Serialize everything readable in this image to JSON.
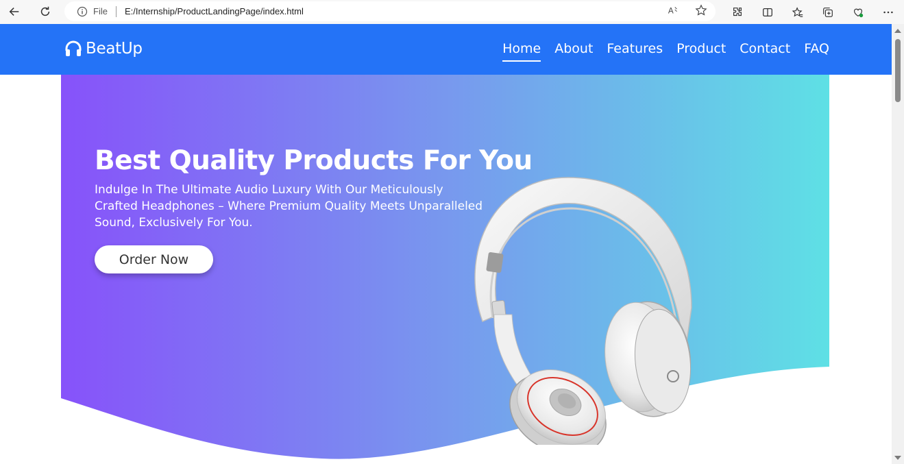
{
  "browser": {
    "scheme_label": "File",
    "url": "E:/Internship/ProductLandingPage/index.html"
  },
  "site": {
    "brand": "BeatUp",
    "nav": [
      {
        "label": "Home",
        "active": true
      },
      {
        "label": "About",
        "active": false
      },
      {
        "label": "Features",
        "active": false
      },
      {
        "label": "Product",
        "active": false
      },
      {
        "label": "Contact",
        "active": false
      },
      {
        "label": "FAQ",
        "active": false
      }
    ]
  },
  "hero": {
    "title": "Best Quality Products For You",
    "subtitle": "Indulge In The Ultimate Audio Luxury With Our Meticulously Crafted Headphones – Where Premium Quality Meets Unparalleled Sound, Exclusively For You.",
    "cta_label": "Order Now"
  },
  "colors": {
    "navbar": "#2473f7",
    "gradient_start": "#8752fa",
    "gradient_end": "#5ee0e5",
    "cta_text": "#333333"
  }
}
